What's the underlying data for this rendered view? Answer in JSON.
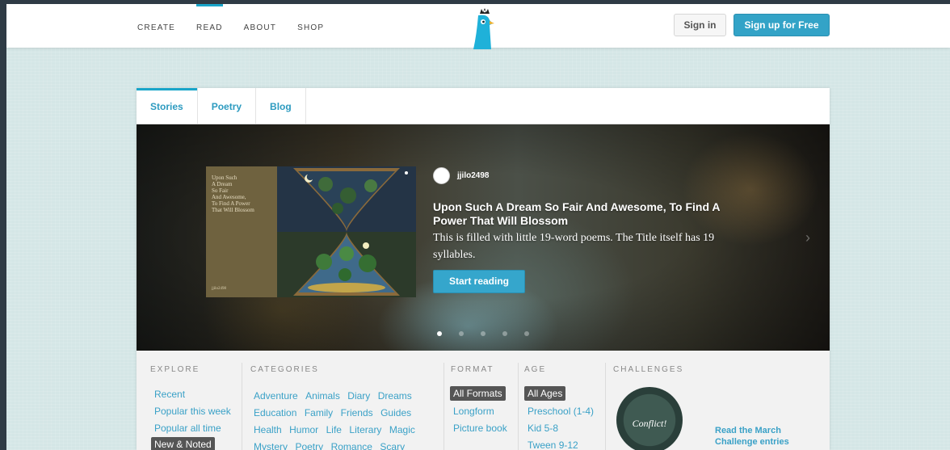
{
  "nav": {
    "links": [
      "CREATE",
      "READ",
      "ABOUT",
      "SHOP"
    ],
    "active": "READ",
    "signin": "Sign in",
    "signup": "Sign up for Free"
  },
  "tabs": [
    "Stories",
    "Poetry",
    "Blog"
  ],
  "featured": {
    "cover_title": "Upon Such\nA Dream\nSo Fair\nAnd Awesome,\nTo Find A Power\nThat Will Blossom",
    "cover_author": "jjilo2498",
    "author": "jjilo2498",
    "title": "Upon Such A Dream So Fair And Awesome, To Find A Power That Will Blossom",
    "description": "This is filled with little 19-word poems. The Title itself has 19 syllables.",
    "cta": "Start reading",
    "slide_count": 5,
    "active_slide": 1
  },
  "explore": {
    "heading": "EXPLORE",
    "items": [
      "Recent",
      "Popular this week",
      "Popular all time",
      "New & Noted"
    ],
    "selected": "New & Noted"
  },
  "categories": {
    "heading": "CATEGORIES",
    "rows": [
      [
        "Adventure",
        "Animals",
        "Diary",
        "Dreams"
      ],
      [
        "Education",
        "Family",
        "Friends",
        "Guides"
      ],
      [
        "Health",
        "Humor",
        "Life",
        "Literary",
        "Magic"
      ],
      [
        "Mystery",
        "Poetry",
        "Romance",
        "Scary"
      ]
    ]
  },
  "format": {
    "heading": "FORMAT",
    "items": [
      "All Formats",
      "Longform",
      "Picture book"
    ],
    "selected": "All Formats"
  },
  "age": {
    "heading": "AGE",
    "items": [
      "All Ages",
      "Preschool (1-4)",
      "Kid 5-8",
      "Tween 9-12"
    ],
    "selected": "All Ages"
  },
  "challenges": {
    "heading": "CHALLENGES",
    "badge_text": "Conflict!",
    "link": "Read the March Challenge entries"
  },
  "colors": {
    "accent": "#1aa5c9",
    "button": "#33a3c7",
    "background": "#d4e6e6"
  }
}
